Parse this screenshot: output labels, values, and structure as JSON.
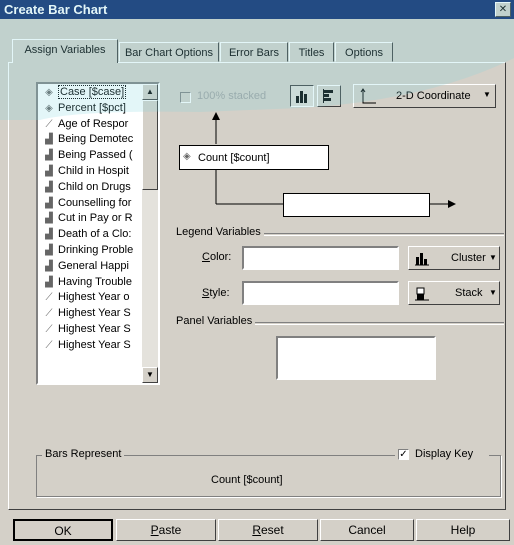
{
  "window": {
    "title": "Create Bar Chart",
    "close_glyph": "✕"
  },
  "tabs": [
    {
      "label": "Assign Variables"
    },
    {
      "label": "Bar Chart Options"
    },
    {
      "label": "Error Bars"
    },
    {
      "label": "Titles"
    },
    {
      "label": "Options"
    }
  ],
  "variables": [
    {
      "label": "Case [$case]",
      "icon": "scale-icon",
      "glyph": "◈"
    },
    {
      "label": "Percent [$pct]",
      "icon": "scale-icon",
      "glyph": "◈"
    },
    {
      "label": "Age of Respor",
      "icon": "ruler-icon",
      "glyph": "⟋"
    },
    {
      "label": "Being Demotec",
      "icon": "nominal-icon",
      "glyph": "▟"
    },
    {
      "label": "Being Passed (",
      "icon": "nominal-icon",
      "glyph": "▟"
    },
    {
      "label": "Child in Hospit",
      "icon": "nominal-icon",
      "glyph": "▟"
    },
    {
      "label": "Child on Drugs",
      "icon": "nominal-icon",
      "glyph": "▟"
    },
    {
      "label": "Counselling for",
      "icon": "nominal-icon",
      "glyph": "▟"
    },
    {
      "label": "Cut in Pay or R",
      "icon": "nominal-icon",
      "glyph": "▟"
    },
    {
      "label": "Death of a Clo:",
      "icon": "nominal-icon",
      "glyph": "▟"
    },
    {
      "label": "Drinking Proble",
      "icon": "nominal-icon",
      "glyph": "▟"
    },
    {
      "label": "General Happi",
      "icon": "nominal-icon",
      "glyph": "▟"
    },
    {
      "label": "Having Trouble",
      "icon": "nominal-icon",
      "glyph": "▟"
    },
    {
      "label": "Highest Year o",
      "icon": "ruler-icon",
      "glyph": "⟋"
    },
    {
      "label": "Highest Year S",
      "icon": "ruler-icon",
      "glyph": "⟋"
    },
    {
      "label": "Highest Year S",
      "icon": "ruler-icon",
      "glyph": "⟋"
    },
    {
      "label": "Highest Year S",
      "icon": "ruler-icon",
      "glyph": "⟋"
    }
  ],
  "toolbar": {
    "stacked_label": "100% stacked",
    "coordinate_label": "2-D Coordinate"
  },
  "y_axis_field": {
    "value": "Count [$count]"
  },
  "x_axis_field": {
    "value": ""
  },
  "legend": {
    "title": "Legend Variables",
    "color_label": "Color:",
    "color_value": "",
    "color_mode": "Cluster",
    "style_label": "Style:",
    "style_value": "",
    "style_mode": "Stack"
  },
  "panel": {
    "title": "Panel Variables",
    "value": ""
  },
  "bars_represent": {
    "title": "Bars Represent",
    "value": "Count [$count]",
    "display_key_label": "Display Key",
    "display_key_checked": true
  },
  "buttons": {
    "ok": "OK",
    "paste": "Paste",
    "reset": "Reset",
    "cancel": "Cancel",
    "help": "Help"
  }
}
